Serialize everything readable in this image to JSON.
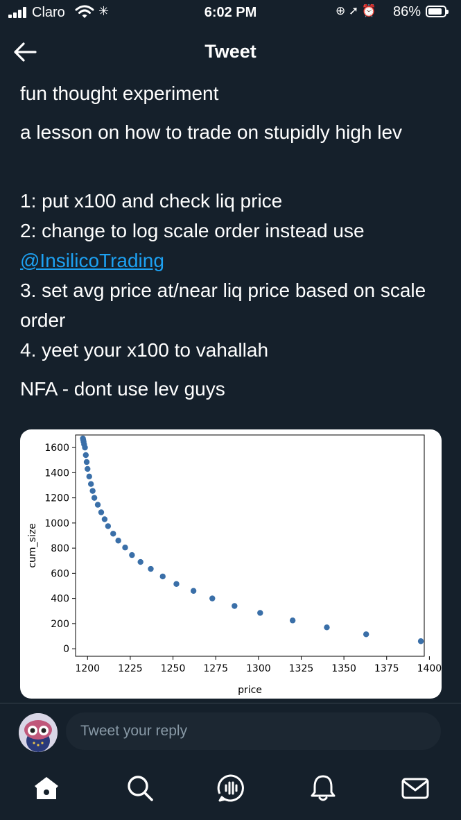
{
  "status_bar": {
    "carrier": "Claro",
    "time": "6:02 PM",
    "battery_percent": "86%",
    "battery_level": 0.86
  },
  "header": {
    "title": "Tweet",
    "back_icon": "arrow-left-icon"
  },
  "tweet": {
    "paragraphs": {
      "p1": "fun thought experiment",
      "p2": "a lesson on how to trade on stupidly high lev",
      "p3_line1": "1: put x100 and check liq price",
      "p3_line2": "2: change to log scale order instead use",
      "mention": "@InsilicoTrading",
      "p3_line3": "3. set avg price at/near liq price based on scale order",
      "p3_line4": "4. yeet your x100 to vahallah",
      "p4": "NFA - dont use lev guys"
    },
    "link_color": "#1da1f2"
  },
  "chart_data": {
    "type": "scatter",
    "xlabel": "price",
    "ylabel": "cum_size",
    "xlim": [
      1193,
      1397
    ],
    "ylim": [
      -60,
      1700
    ],
    "x_ticks": [
      "1200",
      "1225",
      "1250",
      "1275",
      "1300",
      "1325",
      "1350",
      "1375",
      "1400"
    ],
    "y_ticks": [
      "0",
      "200",
      "400",
      "600",
      "800",
      "1000",
      "1200",
      "1400",
      "1600"
    ],
    "grid": false,
    "marker_color": "#3a6fa8",
    "x": [
      1395,
      1363,
      1340,
      1320,
      1301,
      1286,
      1273,
      1262,
      1252,
      1244,
      1237,
      1231,
      1226,
      1222,
      1218,
      1215,
      1212,
      1210,
      1208,
      1206,
      1204,
      1203,
      1202,
      1201,
      1200,
      1199.5,
      1199,
      1198.5,
      1198,
      1197.7,
      1197.5,
      1197.3
    ],
    "y": [
      60,
      115,
      170,
      225,
      285,
      340,
      400,
      460,
      515,
      575,
      635,
      690,
      745,
      805,
      860,
      915,
      975,
      1030,
      1085,
      1145,
      1200,
      1255,
      1310,
      1370,
      1430,
      1485,
      1540,
      1600,
      1625,
      1645,
      1660,
      1672
    ]
  },
  "reply_bar": {
    "placeholder": "Tweet your reply"
  },
  "tab_bar": {
    "icons": [
      "home-icon",
      "search-icon",
      "spaces-icon",
      "notifications-icon",
      "messages-icon"
    ]
  }
}
